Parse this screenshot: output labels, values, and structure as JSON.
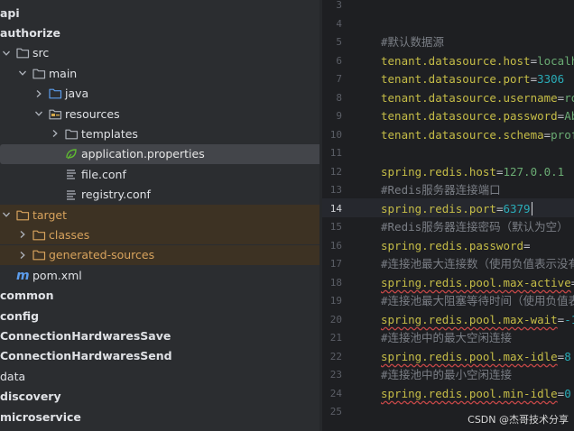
{
  "project_tree": {
    "items": [
      {
        "label": "api",
        "icon": "none",
        "indent": 0,
        "style": "bold"
      },
      {
        "label": "authorize",
        "icon": "none",
        "indent": 0,
        "style": "bold"
      },
      {
        "label": "src",
        "icon": "folder-icon",
        "chevron": "down",
        "indent": 0
      },
      {
        "label": "main",
        "icon": "folder-icon",
        "chevron": "down",
        "indent": 1
      },
      {
        "label": "java",
        "icon": "source-folder-icon",
        "chevron": "right",
        "indent": 2
      },
      {
        "label": "resources",
        "icon": "resources-folder-icon",
        "chevron": "down",
        "indent": 2
      },
      {
        "label": "templates",
        "icon": "folder-icon",
        "chevron": "right",
        "indent": 3
      },
      {
        "label": "application.properties",
        "icon": "spring-properties-icon",
        "indent": 3,
        "style": "selected"
      },
      {
        "label": "file.conf",
        "icon": "config-file-icon",
        "indent": 3
      },
      {
        "label": "registry.conf",
        "icon": "config-file-icon",
        "indent": 3
      },
      {
        "label": "target",
        "icon": "excluded-folder-icon",
        "chevron": "down",
        "indent": 0,
        "style": "orange"
      },
      {
        "label": "classes",
        "icon": "excluded-folder-icon",
        "chevron": "right",
        "indent": 1,
        "style": "orange"
      },
      {
        "label": "generated-sources",
        "icon": "excluded-folder-icon",
        "chevron": "right",
        "indent": 1,
        "style": "orange"
      },
      {
        "label": "pom.xml",
        "icon": "maven-icon",
        "indent": 0
      },
      {
        "label": "common",
        "icon": "none",
        "indent": 0,
        "style": "bold"
      },
      {
        "label": "config",
        "icon": "none",
        "indent": 0,
        "style": "bold"
      },
      {
        "label": "ConnectionHardwaresSave",
        "icon": "none",
        "indent": 0,
        "style": "bold"
      },
      {
        "label": "ConnectionHardwaresSend",
        "icon": "none",
        "indent": 0,
        "style": "bold"
      },
      {
        "label": "data",
        "icon": "none",
        "indent": 0
      },
      {
        "label": "discovery",
        "icon": "none",
        "indent": 0,
        "style": "bold"
      },
      {
        "label": "microservice",
        "icon": "none",
        "indent": 0,
        "style": "bold"
      }
    ]
  },
  "editor": {
    "current_line": "14",
    "lines": [
      {
        "n": "3",
        "key": "",
        "eq": "",
        "val": "",
        "comment": ""
      },
      {
        "n": "4",
        "key": "",
        "eq": "",
        "val": "",
        "comment": ""
      },
      {
        "n": "5",
        "key": "",
        "eq": "",
        "val": "",
        "comment": "#默认数据源"
      },
      {
        "n": "6",
        "key": "tenant.datasource.host",
        "eq": "=",
        "val": "localh",
        "comment": ""
      },
      {
        "n": "7",
        "key": "tenant.datasource.port",
        "eq": "=",
        "val": "3306",
        "comment": ""
      },
      {
        "n": "8",
        "key": "tenant.datasource.username",
        "eq": "=",
        "val": "ro",
        "comment": ""
      },
      {
        "n": "9",
        "key": "tenant.datasource.password",
        "eq": "=",
        "val": "Ab",
        "comment": ""
      },
      {
        "n": "10",
        "key": "tenant.datasource.schema",
        "eq": "=",
        "val": "prof",
        "comment": ""
      },
      {
        "n": "11",
        "key": "",
        "eq": "",
        "val": "",
        "comment": ""
      },
      {
        "n": "12",
        "key": "spring.redis.host",
        "eq": "=",
        "val": "127.0.0.1",
        "comment": ""
      },
      {
        "n": "13",
        "key": "",
        "eq": "",
        "val": "",
        "comment": "#Redis服务器连接端口"
      },
      {
        "n": "14",
        "key": "spring.redis.port",
        "eq": "=",
        "val": "6379",
        "comment": ""
      },
      {
        "n": "15",
        "key": "",
        "eq": "",
        "val": "",
        "comment": "#Redis服务器连接密码（默认为空）"
      },
      {
        "n": "16",
        "key": "spring.redis.password",
        "eq": "=",
        "val": "",
        "comment": ""
      },
      {
        "n": "17",
        "key": "",
        "eq": "",
        "val": "",
        "comment": "#连接池最大连接数（使用负值表示没有"
      },
      {
        "n": "18",
        "key": "spring.redis.pool.max-active",
        "eq": "=",
        "val": "",
        "comment": ""
      },
      {
        "n": "19",
        "key": "",
        "eq": "",
        "val": "",
        "comment": "#连接池最大阻塞等待时间（使用负值表"
      },
      {
        "n": "20",
        "key": "spring.redis.pool.max-wait",
        "eq": "=",
        "val": "-1",
        "comment": ""
      },
      {
        "n": "21",
        "key": "",
        "eq": "",
        "val": "",
        "comment": "#连接池中的最大空闲连接"
      },
      {
        "n": "22",
        "key": "spring.redis.pool.max-idle",
        "eq": "=",
        "val": "8",
        "comment": ""
      },
      {
        "n": "23",
        "key": "",
        "eq": "",
        "val": "",
        "comment": "#连接池中的最小空闲连接"
      },
      {
        "n": "24",
        "key": "spring.redis.pool.min-idle",
        "eq": "=",
        "val": "0",
        "comment": ""
      },
      {
        "n": "25",
        "key": "",
        "eq": "",
        "val": "",
        "comment": ""
      }
    ]
  },
  "watermark": "CSDN @杰哥技术分享",
  "colors": {
    "panel_bg": "#2b2d30",
    "editor_bg": "#1e1f22",
    "property_key": "#c6bd47",
    "property_value": "#6aab73",
    "number_value": "#2aacb8",
    "comment": "#7a7e85",
    "excluded_text": "#d8a35d",
    "selection": "#43454a"
  }
}
